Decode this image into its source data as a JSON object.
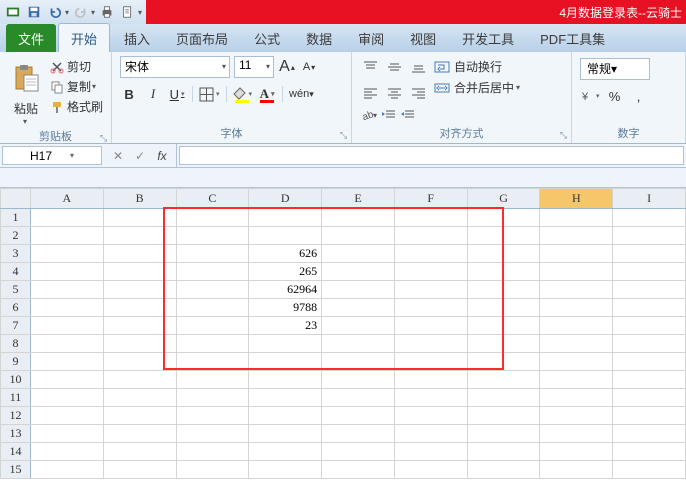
{
  "titlebar": {
    "title": "4月数据登录表--云骑士"
  },
  "qat": {
    "save_icon": "save-icon",
    "undo_icon": "undo-icon",
    "redo_icon": "redo-icon",
    "print_icon": "print-icon",
    "preview_icon": "preview-icon"
  },
  "tabs": {
    "file": "文件",
    "items": [
      "开始",
      "插入",
      "页面布局",
      "公式",
      "数据",
      "审阅",
      "视图",
      "开发工具",
      "PDF工具集"
    ],
    "active_index": 0
  },
  "ribbon": {
    "clipboard": {
      "paste_label": "粘贴",
      "cut": "剪切",
      "copy": "复制",
      "format_painter": "格式刷",
      "group_label": "剪贴板"
    },
    "font": {
      "font_name": "宋体",
      "font_size": "11",
      "group_label": "字体",
      "fill_color": "#ffff00",
      "font_color": "#ff0000"
    },
    "align": {
      "wrap": "自动换行",
      "merge": "合并后居中",
      "group_label": "对齐方式"
    },
    "number": {
      "format": "常规",
      "group_label": "数字"
    }
  },
  "formula_bar": {
    "cell_ref": "H17",
    "value": ""
  },
  "columns": [
    "A",
    "B",
    "C",
    "D",
    "E",
    "F",
    "G",
    "H",
    "I"
  ],
  "rows": [
    "1",
    "2",
    "3",
    "4",
    "5",
    "6",
    "7",
    "8",
    "9",
    "10",
    "11",
    "12",
    "13",
    "14",
    "15"
  ],
  "active_column": "H",
  "chart_data": {
    "type": "table",
    "cells": {
      "D3": 626,
      "D4": 265,
      "D5": 62964,
      "D6": 9788,
      "D7": 23
    }
  },
  "highlight_box": {
    "top_row": 1,
    "left_col": "C",
    "bottom_row": 9,
    "right_col": "G"
  }
}
